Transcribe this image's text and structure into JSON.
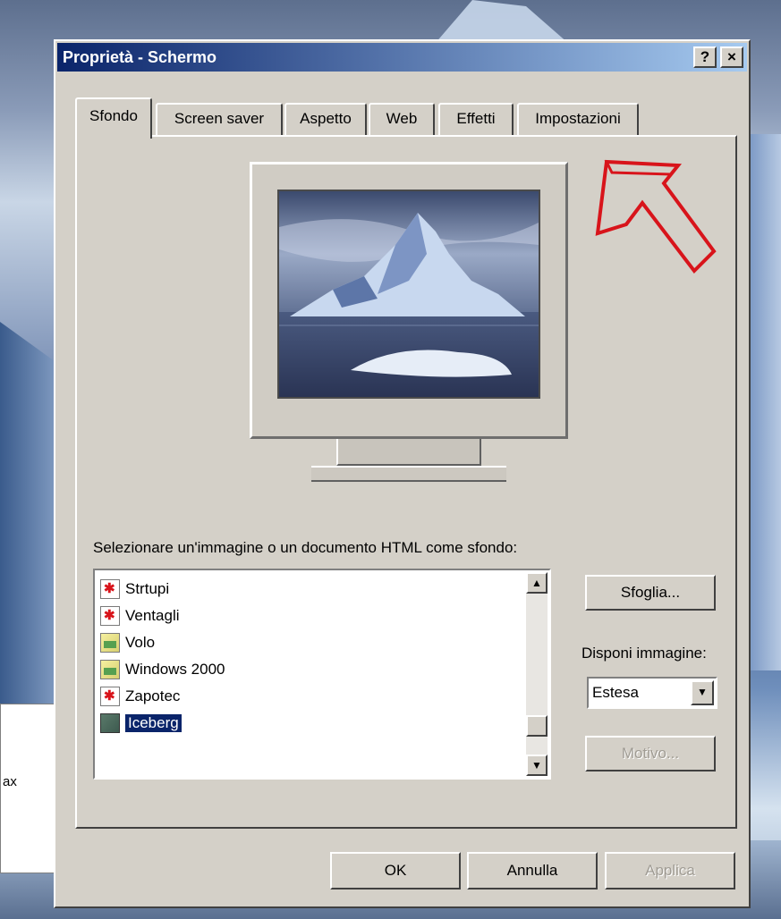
{
  "window": {
    "title": "Proprietà - Schermo",
    "help_label": "?",
    "close_label": "×"
  },
  "tabs": [
    {
      "label": "Sfondo",
      "active": true
    },
    {
      "label": "Screen saver",
      "active": false
    },
    {
      "label": "Aspetto",
      "active": false
    },
    {
      "label": "Web",
      "active": false
    },
    {
      "label": "Effetti",
      "active": false
    },
    {
      "label": "Impostazioni",
      "active": false
    }
  ],
  "sfondo": {
    "list_label": "Selezionare un'immagine o un documento HTML come sfondo:",
    "items": [
      {
        "label": "Strtupi",
        "icon": "html-file-icon"
      },
      {
        "label": "Ventagli",
        "icon": "html-file-icon"
      },
      {
        "label": "Volo",
        "icon": "bitmap-file-icon"
      },
      {
        "label": "Windows 2000",
        "icon": "bitmap-file-icon"
      },
      {
        "label": "Zapotec",
        "icon": "html-file-icon"
      },
      {
        "label": "Iceberg",
        "icon": "bitmap-file-icon",
        "selected": true
      }
    ],
    "browse_label": "Sfoglia...",
    "arrange_label": "Disponi immagine:",
    "arrange_value": "Estesa",
    "pattern_label": "Motivo..."
  },
  "buttons": {
    "ok": "OK",
    "cancel": "Annulla",
    "apply": "Applica"
  },
  "background_window": {
    "fragment": "ax"
  },
  "colors": {
    "titlebar_start": "#0a246a",
    "titlebar_end": "#a6caf0",
    "annotation_arrow": "#d8141b",
    "selection": "#0a246a"
  }
}
